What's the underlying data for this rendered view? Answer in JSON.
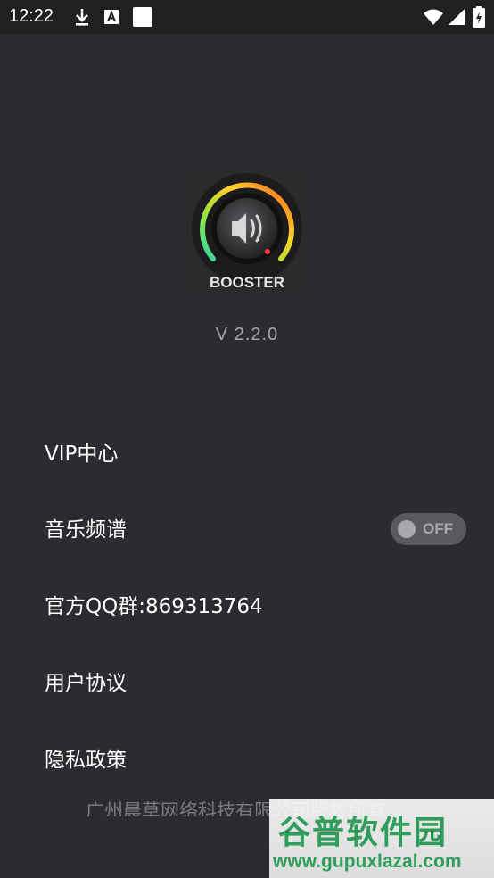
{
  "status_bar": {
    "time": "12:22",
    "icons": [
      "download-icon",
      "font-a-icon",
      "notification-square-icon",
      "wifi-icon",
      "signal-icon",
      "battery-charging-icon"
    ]
  },
  "app": {
    "logo_text": "BOOSTER",
    "version": "V 2.2.0"
  },
  "menu": {
    "vip": "VIP中心",
    "spectrum": "音乐频谱",
    "spectrum_toggle": "OFF",
    "qq_group": "官方QQ群:869313764",
    "user_agreement": "用户协议",
    "privacy_policy": "隐私政策"
  },
  "footer": {
    "copyright": "广州晨草网络科技有限公司版权所有"
  },
  "watermark": {
    "title": "谷普软件园",
    "url": "www.gupuxlazal.com"
  },
  "colors": {
    "background": "#2b2b30",
    "status_bar": "#202023",
    "text": "#ffffff",
    "version_text": "#a8a8ac",
    "toggle_track": "#5a5a5e",
    "watermark_green": "#2e9e5a"
  }
}
